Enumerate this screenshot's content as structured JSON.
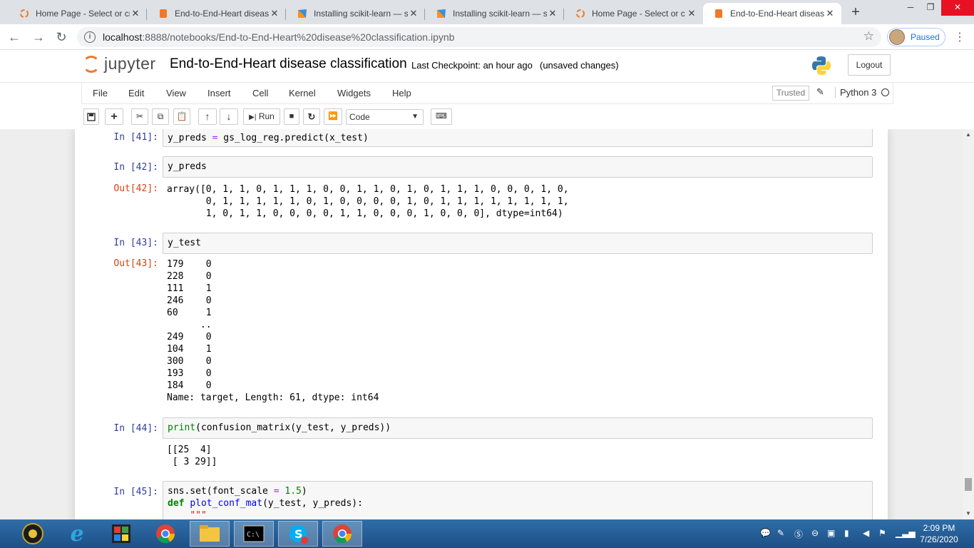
{
  "browser": {
    "tabs": [
      {
        "title": "Home Page - Select or cr",
        "icon": "jupyter-favicon",
        "active": false
      },
      {
        "title": "End-to-End-Heart diseas",
        "icon": "notebook-favicon",
        "active": false
      },
      {
        "title": "Installing scikit-learn — s",
        "icon": "scikit-favicon",
        "active": false
      },
      {
        "title": "Installing scikit-learn — s",
        "icon": "scikit-favicon",
        "active": false
      },
      {
        "title": "Home Page - Select or c",
        "icon": "jupyter-favicon",
        "active": false
      },
      {
        "title": "End-to-End-Heart diseas",
        "icon": "notebook-favicon",
        "active": true
      }
    ],
    "url_host": "localhost",
    "url_path": ":8888/notebooks/End-to-End-Heart%20disease%20classification.ipynb",
    "profile_status": "Paused"
  },
  "jupyter": {
    "logo_text": "jupyter",
    "notebook_name": "End-to-End-Heart disease classification",
    "checkpoint": "Last Checkpoint: an hour ago",
    "save_status": "(unsaved changes)",
    "logout_label": "Logout",
    "menu": [
      "File",
      "Edit",
      "View",
      "Insert",
      "Cell",
      "Kernel",
      "Widgets",
      "Help"
    ],
    "trusted_label": "Trusted",
    "kernel_name": "Python 3",
    "run_label": "Run",
    "cell_type": "Code"
  },
  "cells": {
    "c41": {
      "prompt": "In [41]:"
    },
    "c42": {
      "prompt": "In [42]:",
      "code": "y_preds",
      "out_prompt": "Out[42]:",
      "output": "array([0, 1, 1, 0, 1, 1, 1, 0, 0, 1, 1, 0, 1, 0, 1, 1, 1, 0, 0, 0, 1, 0,\n       0, 1, 1, 1, 1, 1, 0, 1, 0, 0, 0, 0, 1, 0, 1, 1, 1, 1, 1, 1, 1, 1,\n       1, 0, 1, 1, 0, 0, 0, 0, 1, 1, 0, 0, 0, 1, 0, 0, 0], dtype=int64)"
    },
    "c43": {
      "prompt": "In [43]:",
      "code": "y_test",
      "out_prompt": "Out[43]:",
      "output": "179    0\n228    0\n111    1\n246    0\n60     1\n      ..\n249    0\n104    1\n300    0\n193    0\n184    0\nName: target, Length: 61, dtype: int64"
    },
    "c44": {
      "prompt": "In [44]:",
      "output": "[[25  4]\n [ 3 29]]"
    },
    "c45": {
      "prompt": "In [45]:"
    }
  },
  "taskbar": {
    "clock_time": "2:09 PM",
    "clock_date": "7/26/2020"
  },
  "colors": {
    "jupyter_orange": "#f37726",
    "in_prompt": "#303f9f",
    "out_prompt": "#d84315",
    "taskbar": "#1d4f86"
  }
}
